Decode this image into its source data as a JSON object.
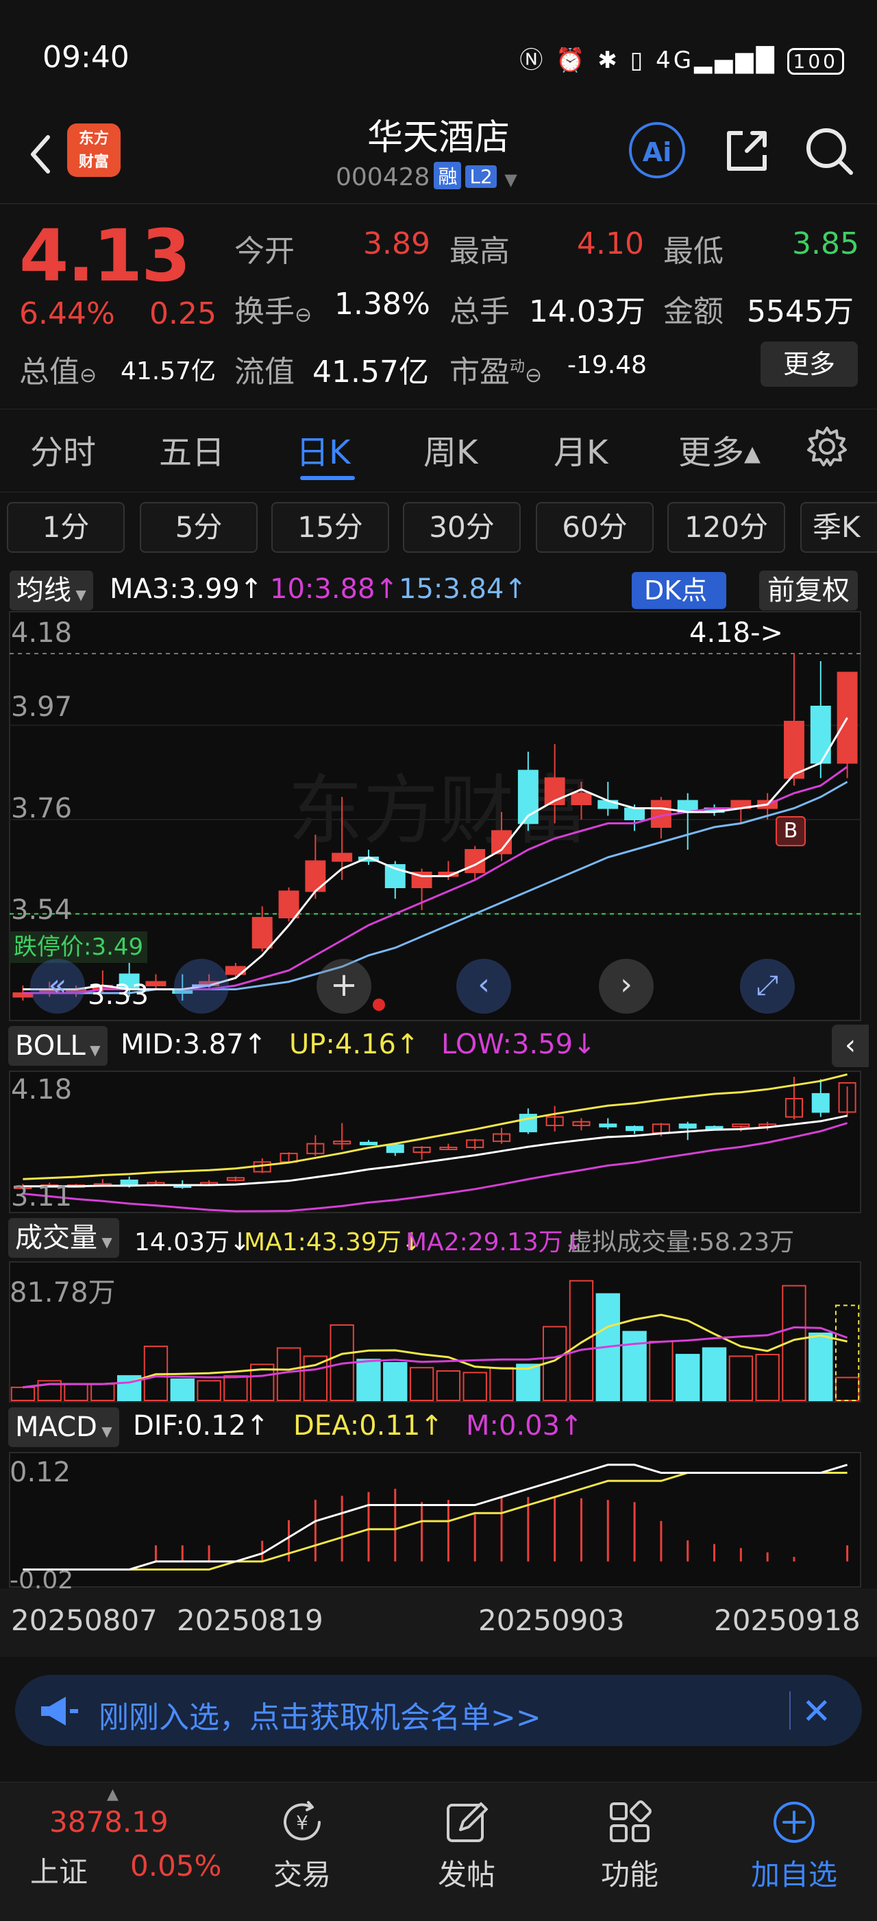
{
  "status_bar": {
    "time": "09:40",
    "right_icons": "NFC · ⏰ · ✱ · 📳 · 4G · 100",
    "battery": "100"
  },
  "header": {
    "title": "华天酒店",
    "code": "000428",
    "tag_rong": "融",
    "tag_l2": "L2",
    "logo_line1": "东方",
    "logo_line2": "财富",
    "ai_label": "Ai"
  },
  "quote": {
    "price": "4.13",
    "pct": "6.44%",
    "change": "0.25",
    "open_label": "今开",
    "open": "3.89",
    "high_label": "最高",
    "high": "4.10",
    "low_label": "最低",
    "low": "3.85",
    "turnover_label": "换手",
    "turnover": "1.38%",
    "volume_label": "总手",
    "volume": "14.03万",
    "amount_label": "金额",
    "amount": "5545万",
    "mktcap_label": "总值",
    "mktcap": "41.57亿",
    "float_label": "流值",
    "float": "41.57亿",
    "pe_label": "市盈",
    "pe_sup": "动",
    "pe": "-19.48",
    "more_label": "更多"
  },
  "tabs": [
    "分时",
    "五日",
    "日K",
    "周K",
    "月K",
    "更多▴"
  ],
  "periods": [
    "1分",
    "5分",
    "15分",
    "30分",
    "60分",
    "120分",
    "季K"
  ],
  "ma_bar": {
    "dropdown": "均线",
    "ma3": "MA3:3.99↑",
    "ma10": "10:3.88↑",
    "ma15": "15:3.84↑",
    "dk": "DK点",
    "fq": "前复权"
  },
  "price_axis": [
    "4.18",
    "3.97",
    "3.76",
    "3.54",
    "3.33"
  ],
  "annot_high": "4.18->",
  "limit_down": "跌停价:3.49",
  "annot_low": "3.33",
  "marker_b": "B",
  "watermark": "东方财富",
  "boll_bar": {
    "dropdown": "BOLL",
    "mid": "MID:3.87↑",
    "up": "UP:4.16↑",
    "low": "LOW:3.59↓",
    "axis_top": "4.18",
    "axis_bottom": "3.11"
  },
  "vol_bar": {
    "dropdown": "成交量",
    "vol": "14.03万↓",
    "ma1": "MA1:43.39万↓",
    "ma2": "MA2:29.13万↓",
    "virt": "虚拟成交量:58.23万",
    "axis_top": "81.78万"
  },
  "macd_bar": {
    "dropdown": "MACD",
    "dif": "DIF:0.12↑",
    "dea": "DEA:0.11↑",
    "m": "M:0.03↑",
    "axis_top": "0.12",
    "axis_bottom": "-0.02"
  },
  "dates": [
    "20250807",
    "20250819",
    "20250903",
    "20250918"
  ],
  "banner": {
    "text": "刚刚入选，点击获取机会名单>>"
  },
  "bottom_nav": {
    "index_value": "3878.19",
    "index_name": "上证",
    "index_change": "0.05%",
    "items": [
      "交易",
      "发帖",
      "功能",
      "加自选"
    ]
  },
  "colors": {
    "up": "#e8403a",
    "down": "#5ce8f0",
    "accent": "#3c86ff",
    "ma3": "#ffffff",
    "ma10": "#d63fd6",
    "ma15": "#7ab8f5",
    "yellow": "#f2e64a"
  },
  "chart_data": {
    "type": "candlestick",
    "ylim": [
      3.24,
      4.24
    ],
    "candles": [
      {
        "o": 3.28,
        "h": 3.3,
        "l": 3.26,
        "c": 3.27
      },
      {
        "o": 3.28,
        "h": 3.31,
        "l": 3.27,
        "c": 3.29
      },
      {
        "o": 3.28,
        "h": 3.3,
        "l": 3.27,
        "c": 3.29
      },
      {
        "o": 3.29,
        "h": 3.34,
        "l": 3.28,
        "c": 3.3
      },
      {
        "o": 3.33,
        "h": 3.36,
        "l": 3.27,
        "c": 3.29
      },
      {
        "o": 3.3,
        "h": 3.33,
        "l": 3.29,
        "c": 3.31
      },
      {
        "o": 3.29,
        "h": 3.33,
        "l": 3.26,
        "c": 3.28
      },
      {
        "o": 3.3,
        "h": 3.33,
        "l": 3.29,
        "c": 3.31
      },
      {
        "o": 3.33,
        "h": 3.36,
        "l": 3.32,
        "c": 3.35
      },
      {
        "o": 3.4,
        "h": 3.51,
        "l": 3.39,
        "c": 3.48
      },
      {
        "o": 3.48,
        "h": 3.56,
        "l": 3.47,
        "c": 3.55
      },
      {
        "o": 3.55,
        "h": 3.7,
        "l": 3.53,
        "c": 3.63
      },
      {
        "o": 3.63,
        "h": 3.8,
        "l": 3.58,
        "c": 3.65
      },
      {
        "o": 3.64,
        "h": 3.66,
        "l": 3.62,
        "c": 3.63
      },
      {
        "o": 3.62,
        "h": 3.63,
        "l": 3.53,
        "c": 3.56
      },
      {
        "o": 3.56,
        "h": 3.61,
        "l": 3.5,
        "c": 3.6
      },
      {
        "o": 3.59,
        "h": 3.63,
        "l": 3.58,
        "c": 3.6
      },
      {
        "o": 3.6,
        "h": 3.67,
        "l": 3.58,
        "c": 3.66
      },
      {
        "o": 3.65,
        "h": 3.76,
        "l": 3.63,
        "c": 3.71
      },
      {
        "o": 3.73,
        "h": 3.92,
        "l": 3.71,
        "c": 3.87
      },
      {
        "o": 3.85,
        "h": 3.94,
        "l": 3.73,
        "c": 3.78
      },
      {
        "o": 3.78,
        "h": 3.84,
        "l": 3.74,
        "c": 3.81
      },
      {
        "o": 3.79,
        "h": 3.84,
        "l": 3.75,
        "c": 3.77
      },
      {
        "o": 3.77,
        "h": 3.78,
        "l": 3.71,
        "c": 3.74
      },
      {
        "o": 3.72,
        "h": 3.8,
        "l": 3.69,
        "c": 3.79
      },
      {
        "o": 3.79,
        "h": 3.81,
        "l": 3.66,
        "c": 3.76
      },
      {
        "o": 3.77,
        "h": 3.78,
        "l": 3.75,
        "c": 3.76
      },
      {
        "o": 3.77,
        "h": 3.78,
        "l": 3.73,
        "c": 3.79
      },
      {
        "o": 3.77,
        "h": 3.81,
        "l": 3.74,
        "c": 3.79
      },
      {
        "o": 3.85,
        "h": 4.18,
        "l": 3.83,
        "c": 4.0
      },
      {
        "o": 4.04,
        "h": 4.16,
        "l": 3.85,
        "c": 3.89
      },
      {
        "o": 3.89,
        "h": 4.1,
        "l": 3.85,
        "c": 4.13
      }
    ],
    "up_flags": [
      true,
      true,
      true,
      true,
      false,
      true,
      false,
      true,
      true,
      true,
      true,
      true,
      true,
      false,
      false,
      true,
      true,
      true,
      true,
      false,
      true,
      true,
      false,
      false,
      true,
      false,
      false,
      true,
      true,
      true,
      false,
      true
    ],
    "ma3": [
      3.29,
      3.29,
      3.29,
      3.3,
      3.29,
      3.29,
      3.29,
      3.3,
      3.32,
      3.38,
      3.46,
      3.55,
      3.61,
      3.64,
      3.61,
      3.59,
      3.59,
      3.62,
      3.66,
      3.75,
      3.79,
      3.82,
      3.79,
      3.77,
      3.77,
      3.76,
      3.76,
      3.77,
      3.78,
      3.86,
      3.89,
      4.01
    ],
    "ma10": [
      3.28,
      3.28,
      3.28,
      3.29,
      3.29,
      3.29,
      3.29,
      3.29,
      3.3,
      3.32,
      3.34,
      3.38,
      3.42,
      3.46,
      3.49,
      3.52,
      3.55,
      3.58,
      3.62,
      3.66,
      3.69,
      3.71,
      3.73,
      3.73,
      3.75,
      3.76,
      3.77,
      3.77,
      3.78,
      3.81,
      3.83,
      3.88
    ],
    "ma15": [
      3.28,
      3.28,
      3.28,
      3.28,
      3.28,
      3.29,
      3.29,
      3.29,
      3.29,
      3.3,
      3.31,
      3.33,
      3.35,
      3.38,
      3.4,
      3.43,
      3.46,
      3.49,
      3.52,
      3.55,
      3.58,
      3.61,
      3.64,
      3.66,
      3.68,
      3.7,
      3.72,
      3.73,
      3.75,
      3.77,
      3.8,
      3.84
    ],
    "limit_down": 3.49,
    "high_marker": 4.18,
    "volume": [
      8,
      12,
      10,
      10,
      15,
      33,
      13,
      12,
      15,
      22,
      32,
      27,
      46,
      25,
      23,
      20,
      18,
      17,
      20,
      22,
      45,
      73,
      65,
      42,
      36,
      28,
      32,
      27,
      28,
      70,
      41,
      14
    ],
    "vol_ylim": [
      0,
      82
    ],
    "macd_dif": [
      -0.01,
      -0.01,
      -0.01,
      -0.01,
      -0.01,
      0.0,
      0.0,
      0.0,
      0.0,
      0.01,
      0.03,
      0.05,
      0.06,
      0.07,
      0.07,
      0.07,
      0.07,
      0.07,
      0.08,
      0.09,
      0.1,
      0.11,
      0.12,
      0.12,
      0.11,
      0.11,
      0.11,
      0.11,
      0.11,
      0.11,
      0.11,
      0.12
    ],
    "macd_dea": [
      -0.01,
      -0.01,
      -0.01,
      -0.01,
      -0.01,
      -0.01,
      -0.01,
      -0.01,
      0.0,
      0.0,
      0.01,
      0.02,
      0.03,
      0.04,
      0.04,
      0.05,
      0.05,
      0.06,
      0.06,
      0.07,
      0.08,
      0.09,
      0.1,
      0.1,
      0.1,
      0.11,
      0.11,
      0.11,
      0.11,
      0.11,
      0.11,
      0.11
    ],
    "macd_ylim": [
      -0.03,
      0.13
    ]
  }
}
